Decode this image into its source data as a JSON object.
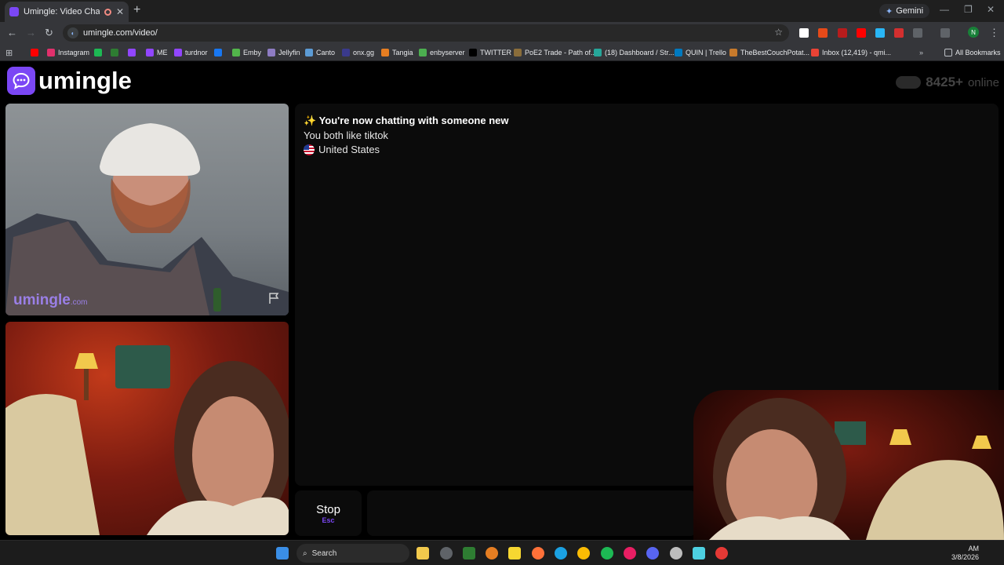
{
  "browser": {
    "tab_title": "Umingle: Video Chat with S",
    "tab_close": "✕",
    "new_tab": "+",
    "gemini_label": "Gemini",
    "url": "umingle.com/video/",
    "profile_initial": "N",
    "bookmarks": [
      {
        "label": "",
        "color": "#ff0000"
      },
      {
        "label": "Instagram",
        "color": "#e1306c"
      },
      {
        "label": "",
        "color": "#1db954"
      },
      {
        "label": "",
        "color": "#2e7d32"
      },
      {
        "label": "",
        "color": "#9146ff"
      },
      {
        "label": "ME",
        "color": "#9146ff"
      },
      {
        "label": "turdnor",
        "color": "#9146ff"
      },
      {
        "label": "",
        "color": "#1877f2"
      },
      {
        "label": "Emby",
        "color": "#52b54b"
      },
      {
        "label": "Jellyfin",
        "color": "#8e7cc3"
      },
      {
        "label": "Canto",
        "color": "#5c9bd5"
      },
      {
        "label": "onx.gg",
        "color": "#3a3a8c"
      },
      {
        "label": "Tangia",
        "color": "#e67e22"
      },
      {
        "label": "enbyserver",
        "color": "#4caf50"
      },
      {
        "label": "TWITTER",
        "color": "#000000"
      },
      {
        "label": "PoE2 Trade - Path of...",
        "color": "#8a6d3b"
      },
      {
        "label": "(18) Dashboard / Str...",
        "color": "#26a69a"
      },
      {
        "label": "QUIN | Trello",
        "color": "#0079bf"
      },
      {
        "label": "TheBestCouchPotat...",
        "color": "#c77a2c"
      },
      {
        "label": "Inbox (12,419) - qmi...",
        "color": "#ea4335"
      }
    ],
    "all_bookmarks": "All Bookmarks"
  },
  "page": {
    "brand": "umingle",
    "online_count": "8425+",
    "online_label": "online",
    "watermark_main": "umingle",
    "watermark_suffix": ".com",
    "chat": {
      "line1": "✨ You're now chatting with someone new",
      "line2": "You both like tiktok",
      "country": "United States"
    },
    "stop_label": "Stop",
    "stop_hint": "Esc"
  },
  "taskbar": {
    "search_label": "Search",
    "time": "AM",
    "date": "3/8/2026"
  },
  "colors": {
    "accent": "#7b47f5"
  }
}
